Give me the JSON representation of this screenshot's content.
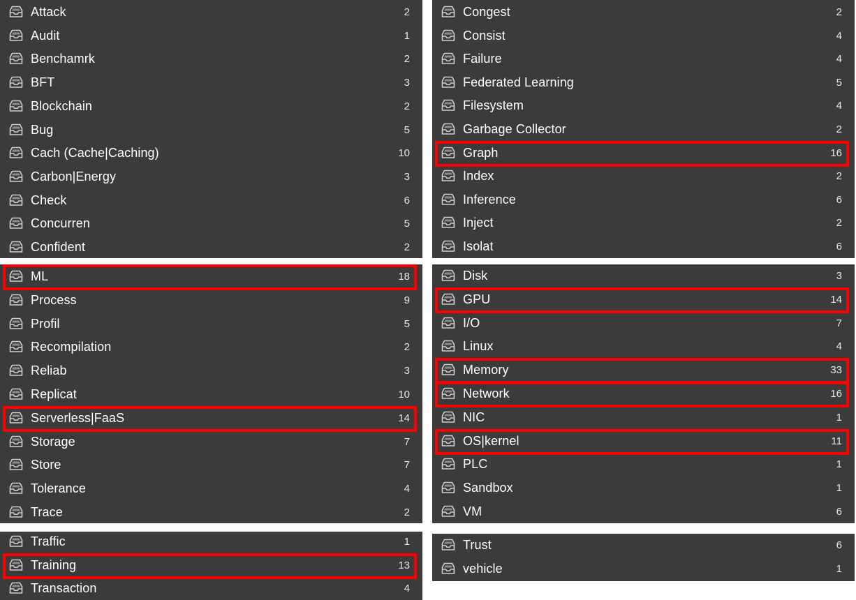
{
  "panels": [
    {
      "items": [
        {
          "label": "Attack",
          "count": "2"
        },
        {
          "label": "Audit",
          "count": "1"
        },
        {
          "label": "Benchamrk",
          "count": "2"
        },
        {
          "label": "BFT",
          "count": "3"
        },
        {
          "label": "Blockchain",
          "count": "2"
        },
        {
          "label": "Bug",
          "count": "5"
        },
        {
          "label": "Cach (Cache|Caching)",
          "count": "10"
        },
        {
          "label": "Carbon|Energy",
          "count": "3"
        },
        {
          "label": "Check",
          "count": "6"
        },
        {
          "label": "Concurren",
          "count": "5"
        },
        {
          "label": "Confident",
          "count": "2"
        }
      ]
    },
    {
      "items": [
        {
          "label": "Congest",
          "count": "2"
        },
        {
          "label": "Consist",
          "count": "4"
        },
        {
          "label": "Failure",
          "count": "4"
        },
        {
          "label": "Federated Learning",
          "count": "5"
        },
        {
          "label": "Filesystem",
          "count": "4"
        },
        {
          "label": "Garbage Collector",
          "count": "2"
        },
        {
          "label": "Graph",
          "count": "16",
          "highlighted": true
        },
        {
          "label": "Index",
          "count": "2"
        },
        {
          "label": "Inference",
          "count": "6"
        },
        {
          "label": "Inject",
          "count": "2"
        },
        {
          "label": "Isolat",
          "count": "6"
        }
      ]
    },
    {
      "items": [
        {
          "label": "ML",
          "count": "18",
          "highlighted": true
        },
        {
          "label": "Process",
          "count": "9"
        },
        {
          "label": "Profil",
          "count": "5"
        },
        {
          "label": "Recompilation",
          "count": "2"
        },
        {
          "label": "Reliab",
          "count": "3"
        },
        {
          "label": "Replicat",
          "count": "10"
        },
        {
          "label": "Serverless|FaaS",
          "count": "14",
          "highlighted": true
        },
        {
          "label": "Storage",
          "count": "7"
        },
        {
          "label": "Store",
          "count": "7"
        },
        {
          "label": "Tolerance",
          "count": "4"
        },
        {
          "label": "Trace",
          "count": "2"
        }
      ]
    },
    {
      "items": [
        {
          "label": "Disk",
          "count": "3"
        },
        {
          "label": "GPU",
          "count": "14",
          "highlighted": true
        },
        {
          "label": "I/O",
          "count": "7"
        },
        {
          "label": "Linux",
          "count": "4"
        },
        {
          "label": "Memory",
          "count": "33",
          "highlighted": true
        },
        {
          "label": "Network",
          "count": "16",
          "highlighted": true
        },
        {
          "label": "NIC",
          "count": "1"
        },
        {
          "label": "OS|kernel",
          "count": "11",
          "highlighted": true
        },
        {
          "label": "PLC",
          "count": "1"
        },
        {
          "label": "Sandbox",
          "count": "1"
        },
        {
          "label": "VM",
          "count": "6"
        }
      ]
    },
    {
      "items": [
        {
          "label": "Traffic",
          "count": "1"
        },
        {
          "label": "Training",
          "count": "13",
          "highlighted": true
        },
        {
          "label": "Transaction",
          "count": "4"
        }
      ]
    },
    {
      "items": [
        {
          "label": "Trust",
          "count": "6"
        },
        {
          "label": "vehicle",
          "count": "1"
        }
      ]
    }
  ],
  "icon": "inbox-tray-icon",
  "colors": {
    "panel_bg": "#3b3b3b",
    "text": "#ffffff",
    "highlight": "#ff0000"
  }
}
